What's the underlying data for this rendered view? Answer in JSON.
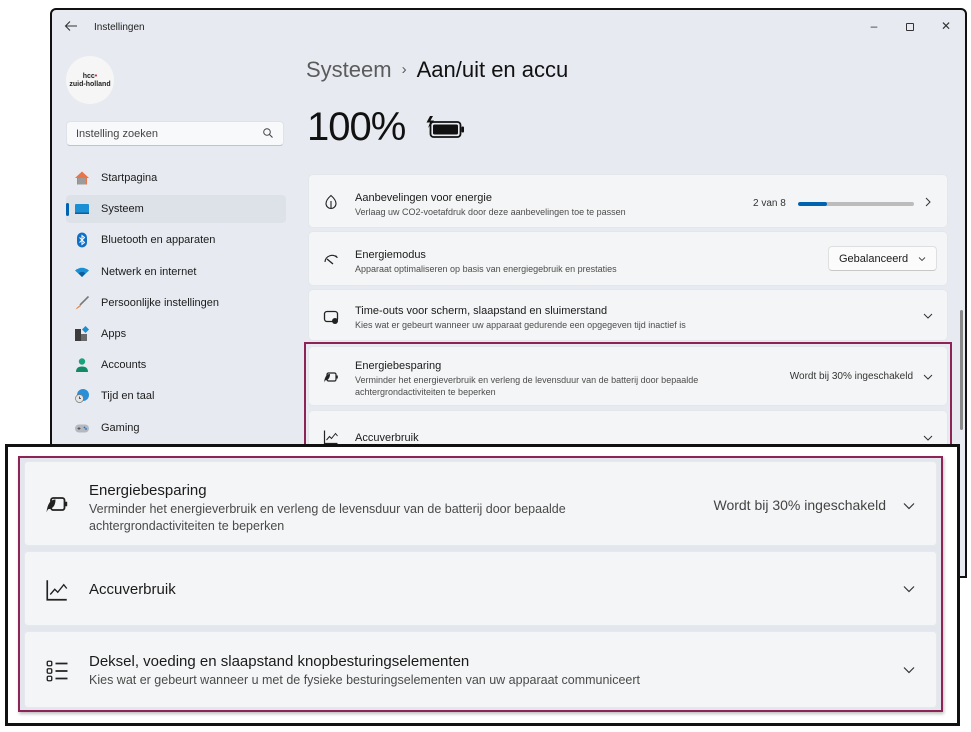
{
  "window": {
    "app_title": "Instellingen",
    "back_icon": "arrow-left-icon",
    "controls": {
      "minimize": "–",
      "maximize": "maximize-icon",
      "close": "✕"
    }
  },
  "profile": {
    "line1": "hcc",
    "line1_dot": "•",
    "line2": "zuid-holland"
  },
  "search": {
    "placeholder": "Instelling zoeken",
    "icon": "search-icon"
  },
  "sidebar": {
    "items": [
      {
        "label": "Startpagina",
        "icon": "home-icon",
        "active": false
      },
      {
        "label": "Systeem",
        "icon": "system-display-icon",
        "active": true
      },
      {
        "label": "Bluetooth en apparaten",
        "icon": "bluetooth-icon",
        "active": false
      },
      {
        "label": "Netwerk en internet",
        "icon": "wifi-icon",
        "active": false
      },
      {
        "label": "Persoonlijke instellingen",
        "icon": "paintbrush-icon",
        "active": false
      },
      {
        "label": "Apps",
        "icon": "apps-icon",
        "active": false
      },
      {
        "label": "Accounts",
        "icon": "account-icon",
        "active": false
      },
      {
        "label": "Tijd en taal",
        "icon": "time-language-icon",
        "active": false
      },
      {
        "label": "Gaming",
        "icon": "gamepad-icon",
        "active": false
      }
    ]
  },
  "breadcrumb": {
    "parent": "Systeem",
    "separator": "›",
    "current": "Aan/uit en accu"
  },
  "battery": {
    "percent_label": "100%",
    "charging": true,
    "icon": "battery-charging-icon"
  },
  "cards": [
    {
      "title": "Aanbevelingen voor energie",
      "subtitle": "Verlaag uw CO2-voetafdruk door deze aanbevelingen toe te passen",
      "icon": "leaf-icon",
      "progress_text": "2 van 8",
      "progress_value": 2,
      "progress_max": 8,
      "trailing": "chevron-right-icon"
    },
    {
      "title": "Energiemodus",
      "subtitle": "Apparaat optimaliseren op basis van energiegebruik en prestaties",
      "icon": "gauge-icon",
      "dropdown_value": "Gebalanceerd",
      "trailing": "chevron-down-icon"
    },
    {
      "title": "Time-outs voor scherm, slaapstand en sluimerstand",
      "subtitle": "Kies wat er gebeurt wanneer uw apparaat gedurende een opgegeven tijd inactief is",
      "icon": "screen-sleep-icon",
      "trailing": "chevron-down-icon"
    },
    {
      "title": "Energiebesparing",
      "subtitle_line1": "Verminder het energieverbruik en verleng de levensduur van de batterij door bepaalde",
      "subtitle_line2": "achtergrondactiviteiten te beperken",
      "icon": "battery-saver-icon",
      "status": "Wordt bij 30% ingeschakeld",
      "trailing": "chevron-down-icon"
    },
    {
      "title": "Accuverbruik",
      "icon": "line-chart-icon",
      "trailing": "chevron-down-icon"
    },
    {
      "title": "Deksel, voeding en slaapstand knopbesturingselementen",
      "subtitle": "Kies wat er gebeurt wanneer u met de fysieke besturingselementen van uw apparaat communiceert",
      "icon": "list-controls-icon",
      "trailing": "chevron-down-icon"
    }
  ],
  "colors": {
    "accent": "#0063b1",
    "highlight_border": "#8c2456",
    "window_bg": "#e7ebf1",
    "card_bg": "#f4f5f6"
  }
}
